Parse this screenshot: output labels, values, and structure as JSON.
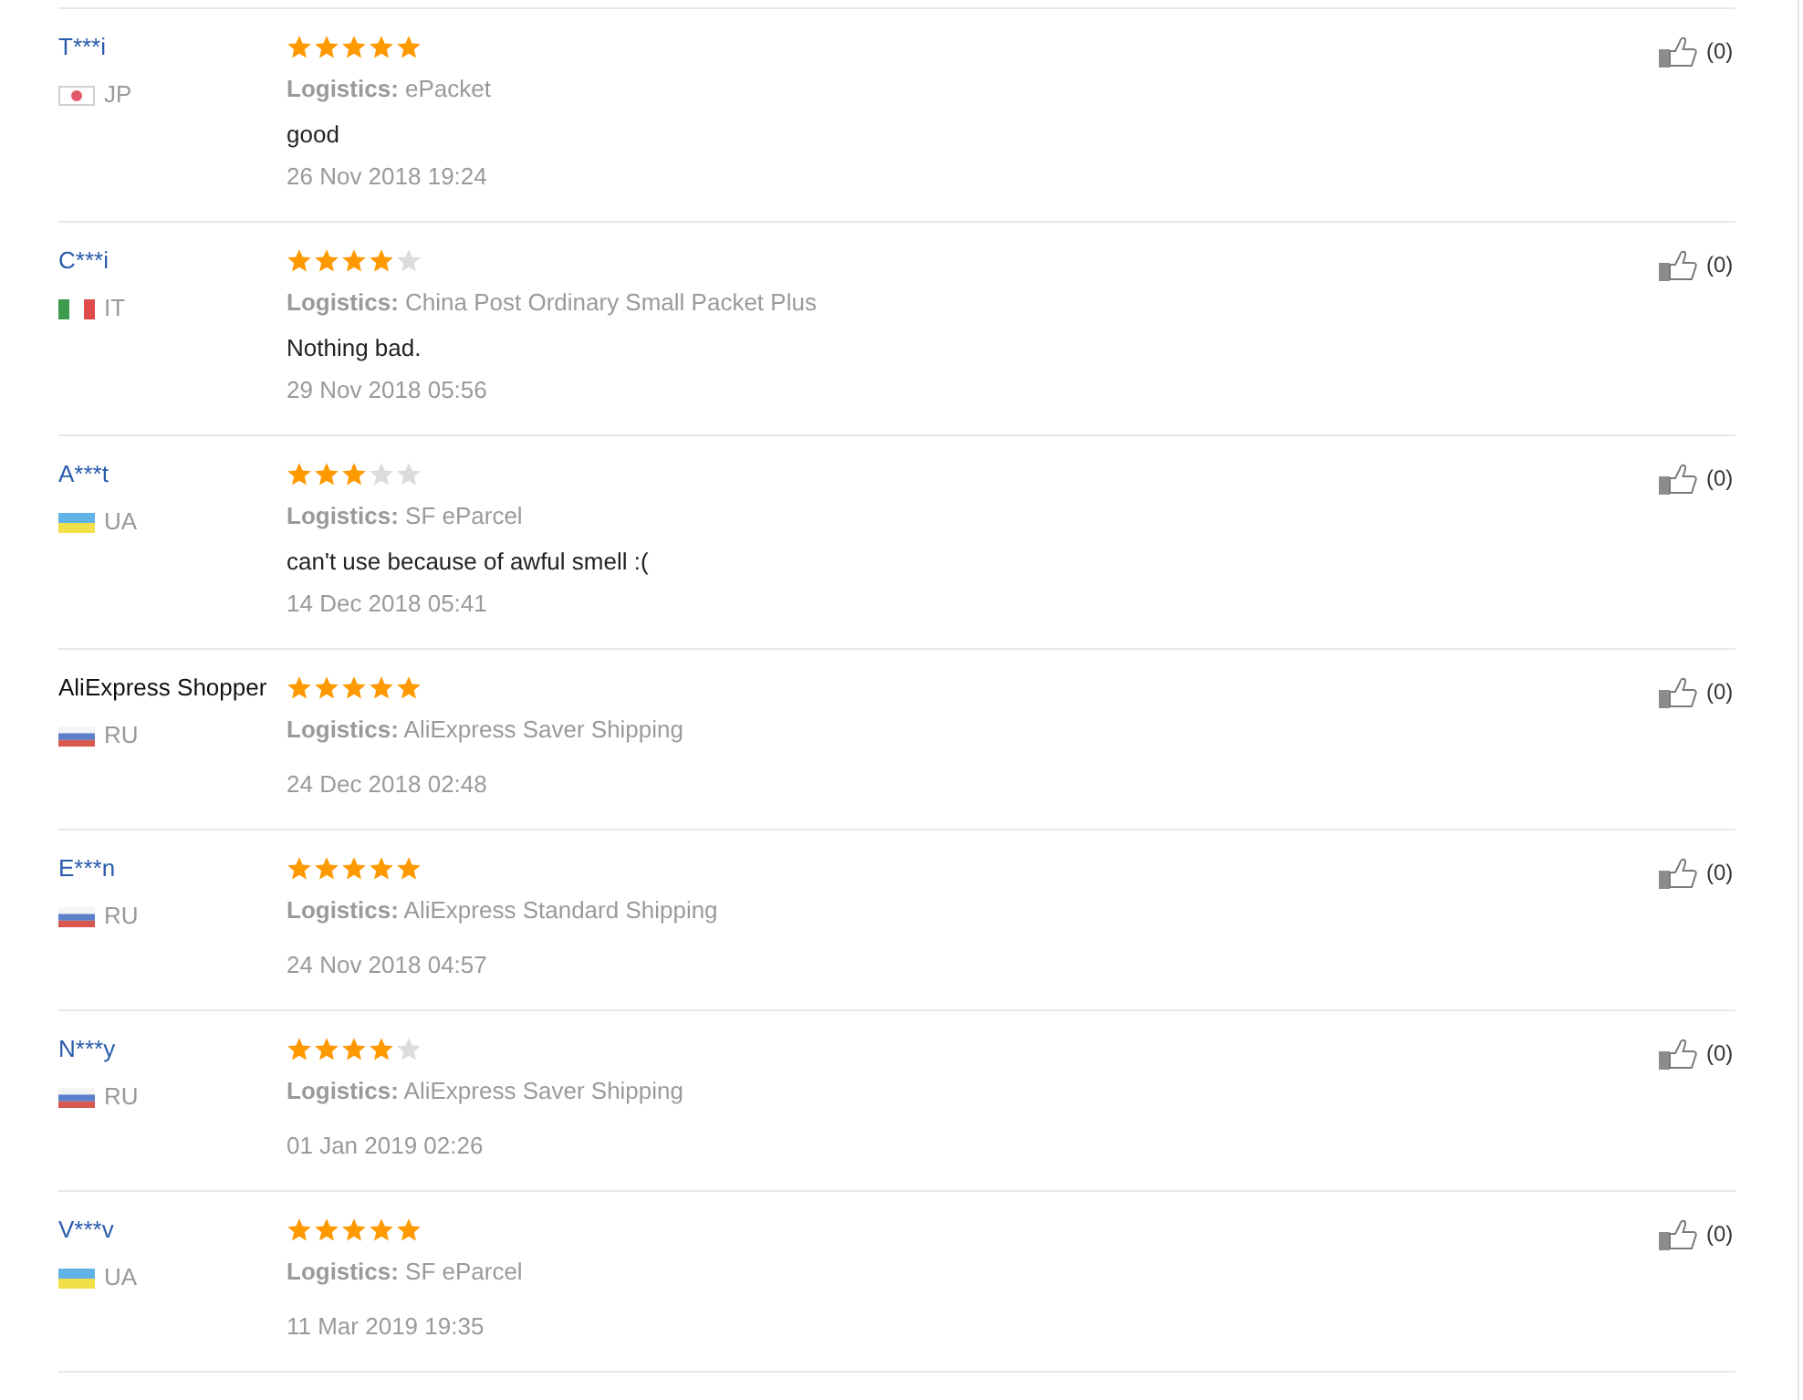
{
  "reviews": [
    {
      "buyer": "T***i",
      "name_is_link": true,
      "flag": {
        "kind": "japan"
      },
      "country": "JP",
      "stars": 5,
      "logistics": "**Logistics:** ePacket",
      "comment": "good",
      "date": "26 Nov 2018 19:24",
      "likes": "(0)"
    },
    {
      "buyer": "C***i",
      "name_is_link": true,
      "flag": {
        "kind": "italy"
      },
      "country": "IT",
      "stars": 4,
      "logistics": "**Logistics:** China Post Ordinary Small Packet Plus",
      "comment": "Nothing bad.",
      "date": "29 Nov 2018 05:56",
      "likes": "(0)"
    },
    {
      "buyer": "A***t",
      "name_is_link": true,
      "flag": {
        "kind": "ukraine"
      },
      "country": "UA",
      "stars": 3,
      "logistics": "**Logistics:** SF eParcel",
      "comment": "can't use because of awful smell :(",
      "date": "14 Dec 2018 05:41",
      "likes": "(0)"
    },
    {
      "buyer": "AliExpress Shopper",
      "name_is_link": false,
      "flag": {
        "kind": "russia"
      },
      "country": "RU",
      "stars": 5,
      "logistics": "**Logistics:** AliExpress Saver Shipping",
      "date": "24 Dec 2018 02:48",
      "likes": "(0)"
    },
    {
      "buyer": "E***n",
      "name_is_link": true,
      "flag": {
        "kind": "russia"
      },
      "country": "RU",
      "stars": 5,
      "logistics": "**Logistics:** AliExpress Standard Shipping",
      "date": "24 Nov 2018 04:57",
      "likes": "(0)"
    },
    {
      "buyer": "N***y",
      "name_is_link": true,
      "flag": {
        "kind": "russia"
      },
      "country": "RU",
      "stars": 4,
      "logistics": "**Logistics:** AliExpress Saver Shipping",
      "date": "01 Jan 2019 02:26",
      "likes": "(0)"
    },
    {
      "buyer": "V***v",
      "name_is_link": true,
      "flag": {
        "kind": "ukraine"
      },
      "country": "UA",
      "stars": 5,
      "logistics": "**Logistics:** SF eParcel",
      "date": "11 Mar 2019 19:35",
      "likes": "(0)"
    }
  ]
}
